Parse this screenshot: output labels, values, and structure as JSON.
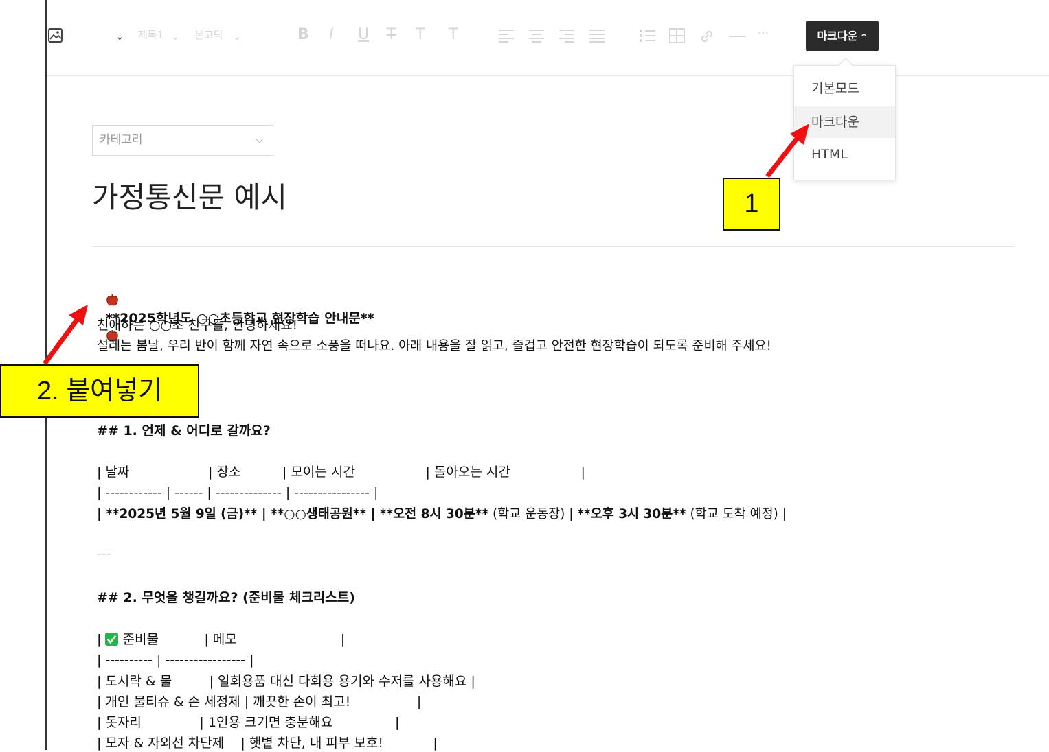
{
  "toolbar": {
    "heading_select": "제목1",
    "font_select": "본고딕",
    "bold_icon": "B",
    "italic_icon": "I",
    "underline_icon": "U",
    "strike_icon": "T",
    "text_color_icon": "T",
    "bg_color_icon": "T",
    "more_icon": "···",
    "mode_button": "마크다운"
  },
  "mode_menu": {
    "items": [
      "기본모드",
      "마크다운",
      "HTML"
    ],
    "selected": "마크다운"
  },
  "category": {
    "placeholder": "카테고리"
  },
  "post_title": "가정통신문 예시",
  "body": {
    "heading": "**2025학년도 ○○초등학교 현장학습 안내문**",
    "greeting": "친애하는 ○○초 친구들, 안녕하세요!",
    "intro": "설레는 봄날, 우리 반이 함께 자연 속으로 소풍을 떠나요. 아래 내용을 잘 읽고, 즐겁고 안전한 현장학습이 되도록 준비해 주세요!",
    "section1_heading": "## 1. 언제 & 어디로 갈까요?",
    "table1_header": "| 날짜                   | 장소          | 모이는 시간                 | 돌아오는 시간                 |",
    "table1_sep": "| ------------ | ------ | -------------- | ---------------- |",
    "table1_row_bold1": "| **2025년 5월 9일 (금)** | **○○생태공원** | **오전 8시 30분**",
    "table1_row_plain1": " (학교 운동장) | ",
    "table1_row_bold2": "**오후 3시 30분**",
    "table1_row_plain2": " (학교 도착 예정) |",
    "md_hr": "---",
    "section2_heading": "## 2. 무엇을 챙길까요? (준비물 체크리스트)",
    "table2_header_pre": "| ",
    "table2_header_post": " 준비물           | 메모                         |",
    "table2_sep": "| ---------- | ----------------- |",
    "table2_rows": [
      "| 도시락 & 물         | 일회용품 대신 다회용 용기와 수저를 사용해요 |",
      "| 개인 물티슈 & 손 세정제 | 깨끗한 손이 최고!                |",
      "| 돗자리              | 1인용 크기면 충분해요               |",
      "| 모자 & 자외선 차단제    | 햇볕 차단, 내 피부 보호!            |"
    ]
  },
  "callouts": {
    "step1": "1",
    "step2": "2. 붙여넣기"
  },
  "colors": {
    "callout_bg": "#ffff00",
    "arrow": "#ee1111",
    "mode_button_bg": "#2b2b2b",
    "checkmark_green": "#2bb24c",
    "apple_red": "#c8321e"
  }
}
